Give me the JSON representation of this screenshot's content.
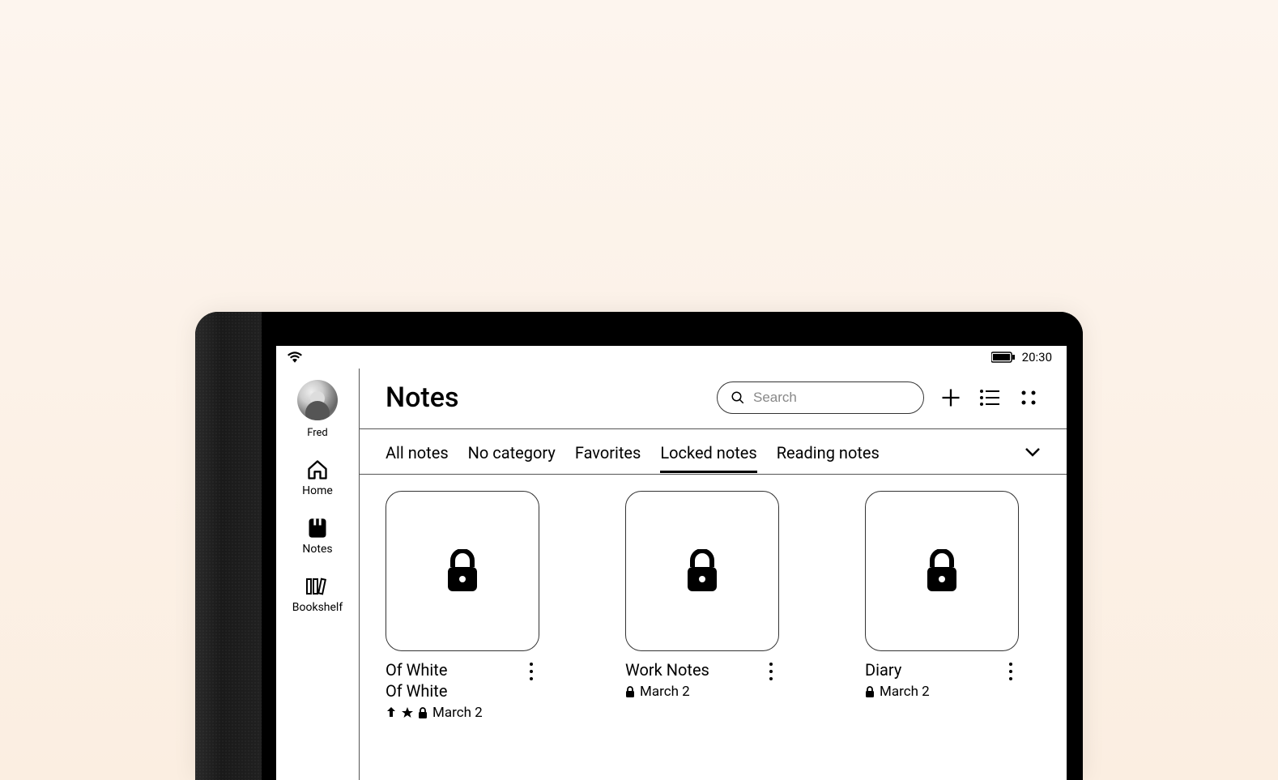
{
  "status": {
    "time": "20:30"
  },
  "sidebar": {
    "user_name": "Fred",
    "items": [
      {
        "label": "Home"
      },
      {
        "label": "Notes"
      },
      {
        "label": "Bookshelf"
      }
    ]
  },
  "header": {
    "title": "Notes",
    "search_placeholder": "Search"
  },
  "tabs": {
    "items": [
      {
        "label": "All notes"
      },
      {
        "label": "No category"
      },
      {
        "label": "Favorites"
      },
      {
        "label": "Locked notes"
      },
      {
        "label": "Reading notes"
      }
    ],
    "active_index": 3
  },
  "notes": [
    {
      "title": "Of White",
      "subtitle": "Of White",
      "date": "March 2",
      "has_sync": true,
      "has_star": true,
      "has_lock": true
    },
    {
      "title": "Work Notes",
      "subtitle": "",
      "date": "March 2",
      "has_sync": false,
      "has_star": false,
      "has_lock": true
    },
    {
      "title": "Diary",
      "subtitle": "",
      "date": "March 2",
      "has_sync": false,
      "has_star": false,
      "has_lock": true
    }
  ]
}
